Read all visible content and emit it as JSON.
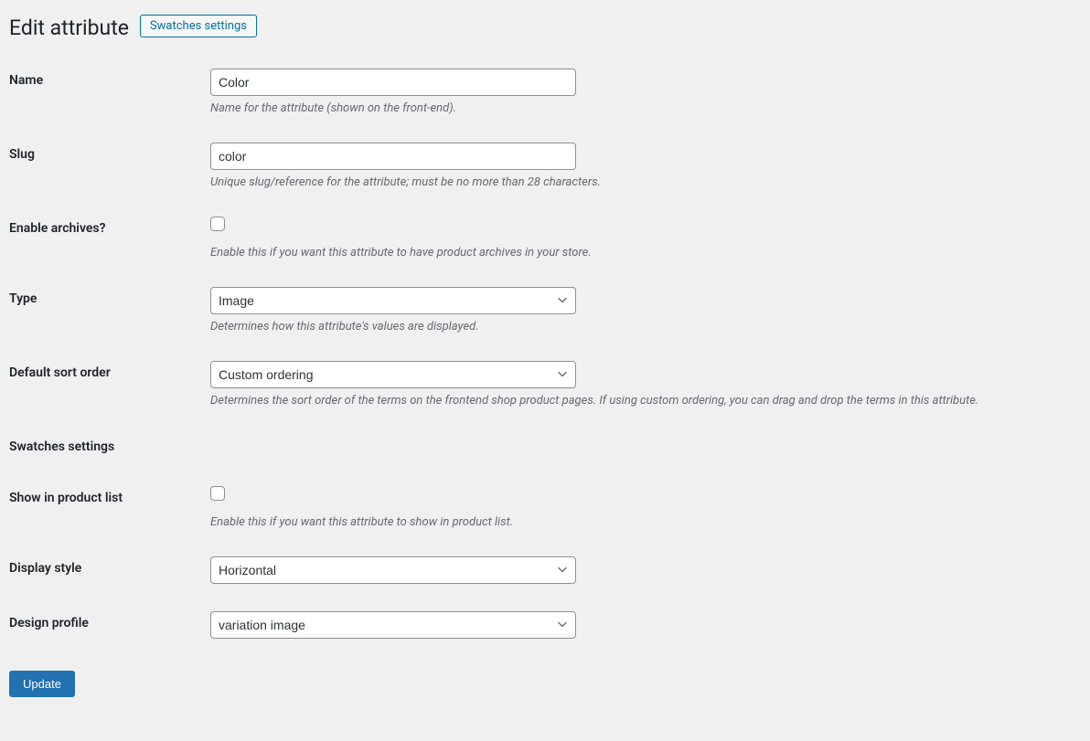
{
  "header": {
    "title": "Edit attribute",
    "swatches_btn": "Swatches settings"
  },
  "fields": {
    "name": {
      "label": "Name",
      "value": "Color",
      "desc": "Name for the attribute (shown on the front-end)."
    },
    "slug": {
      "label": "Slug",
      "value": "color",
      "desc": "Unique slug/reference for the attribute; must be no more than 28 characters."
    },
    "archives": {
      "label": "Enable archives?",
      "desc": "Enable this if you want this attribute to have product archives in your store."
    },
    "type": {
      "label": "Type",
      "value": "Image",
      "desc": "Determines how this attribute's values are displayed."
    },
    "sort": {
      "label": "Default sort order",
      "value": "Custom ordering",
      "desc": "Determines the sort order of the terms on the frontend shop product pages. If using custom ordering, you can drag and drop the terms in this attribute."
    },
    "section_swatches": "Swatches settings",
    "show_list": {
      "label": "Show in product list",
      "desc": "Enable this if you want this attribute to show in product list."
    },
    "display_style": {
      "label": "Display style",
      "value": "Horizontal"
    },
    "design_profile": {
      "label": "Design profile",
      "value": "variation image"
    }
  },
  "actions": {
    "submit": "Update"
  }
}
